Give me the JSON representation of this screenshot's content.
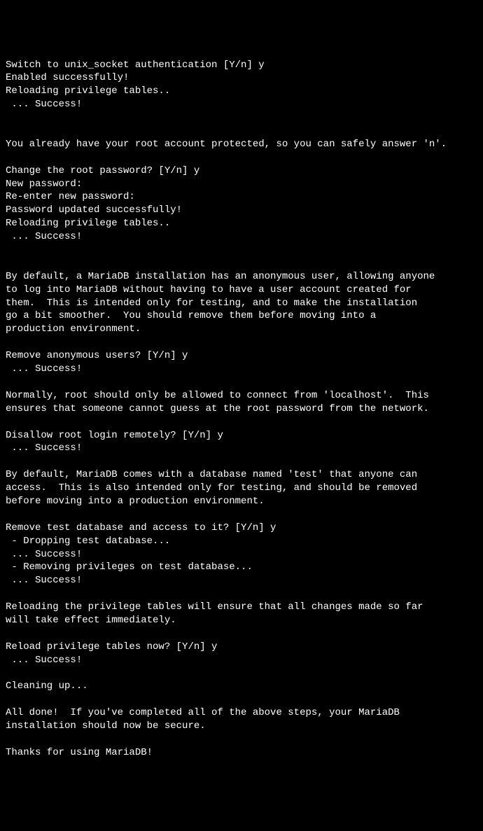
{
  "lines": [
    "Switch to unix_socket authentication [Y/n] y",
    "Enabled successfully!",
    "Reloading privilege tables..",
    " ... Success!",
    "",
    "",
    "You already have your root account protected, so you can safely answer 'n'.",
    "",
    "Change the root password? [Y/n] y",
    "New password:",
    "Re-enter new password:",
    "Password updated successfully!",
    "Reloading privilege tables..",
    " ... Success!",
    "",
    "",
    "By default, a MariaDB installation has an anonymous user, allowing anyone",
    "to log into MariaDB without having to have a user account created for",
    "them.  This is intended only for testing, and to make the installation",
    "go a bit smoother.  You should remove them before moving into a",
    "production environment.",
    "",
    "Remove anonymous users? [Y/n] y",
    " ... Success!",
    "",
    "Normally, root should only be allowed to connect from 'localhost'.  This",
    "ensures that someone cannot guess at the root password from the network.",
    "",
    "Disallow root login remotely? [Y/n] y",
    " ... Success!",
    "",
    "By default, MariaDB comes with a database named 'test' that anyone can",
    "access.  This is also intended only for testing, and should be removed",
    "before moving into a production environment.",
    "",
    "Remove test database and access to it? [Y/n] y",
    " - Dropping test database...",
    " ... Success!",
    " - Removing privileges on test database...",
    " ... Success!",
    "",
    "Reloading the privilege tables will ensure that all changes made so far",
    "will take effect immediately.",
    "",
    "Reload privilege tables now? [Y/n] y",
    " ... Success!",
    "",
    "Cleaning up...",
    "",
    "All done!  If you've completed all of the above steps, your MariaDB",
    "installation should now be secure.",
    "",
    "Thanks for using MariaDB!"
  ]
}
